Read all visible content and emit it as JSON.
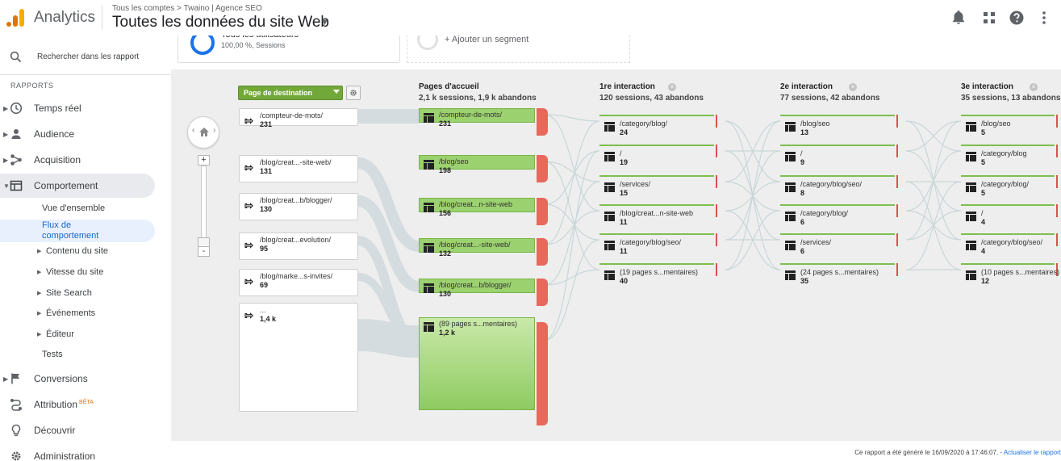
{
  "header": {
    "app_name": "Analytics",
    "breadcrumb": [
      "Tous les comptes",
      ">",
      "Twaino | Agence SEO"
    ],
    "view_title": "Toutes les données du site Web",
    "icons": [
      "notifications-icon",
      "apps-icon",
      "help-icon",
      "more-vert-icon"
    ]
  },
  "sidebar": {
    "search_label": "Rechercher dans les rapport",
    "reports_label": "RAPPORTS",
    "items": [
      {
        "label": "Temps réel",
        "icon": "clock-icon"
      },
      {
        "label": "Audience",
        "icon": "person-icon"
      },
      {
        "label": "Acquisition",
        "icon": "acquisition-icon"
      },
      {
        "label": "Comportement",
        "icon": "behavior-icon"
      }
    ],
    "behavior_sub": [
      {
        "label": "Vue d'ensemble"
      },
      {
        "label": "Flux de comportement"
      },
      {
        "label": "Contenu du site"
      },
      {
        "label": "Vitesse du site"
      },
      {
        "label": "Site Search"
      },
      {
        "label": "Événements"
      },
      {
        "label": "Éditeur"
      },
      {
        "label": "Tests"
      }
    ],
    "bottom_items": [
      {
        "label": "Conversions",
        "icon": "flag-icon"
      },
      {
        "label": "Attribution",
        "badge": "BÊTA",
        "icon": "attribution-icon"
      },
      {
        "label": "Découvrir",
        "icon": "lightbulb-icon"
      },
      {
        "label": "Administration",
        "icon": "gear-icon"
      }
    ]
  },
  "segments": {
    "active": {
      "title": "Tous les utilisateurs",
      "subtitle": "100,00 %, Sessions"
    },
    "add_label": "+ Ajouter un segment"
  },
  "flow": {
    "dimension": "Page de destination",
    "start_pages": [
      {
        "name": "/compteur-de-mots/",
        "value": "231"
      },
      {
        "name": "/blog/creat...-site-web/",
        "value": "131"
      },
      {
        "name": "/blog/creat...b/blogger/",
        "value": "130"
      },
      {
        "name": "/blog/creat...evolution/",
        "value": "95"
      },
      {
        "name": "/blog/marke...s-invites/",
        "value": "69"
      },
      {
        "name": "...",
        "value": "1,4 k"
      }
    ],
    "columns": [
      {
        "title": "Pages d'accueil",
        "subtitle": "2,1 k sessions, 1,9 k abandons",
        "nodes": [
          {
            "name": "/compteur-de-mots/",
            "value": "231"
          },
          {
            "name": "/blog/seo",
            "value": "198"
          },
          {
            "name": "/blog/creat...n-site-web",
            "value": "156"
          },
          {
            "name": "/blog/creat...-site-web/",
            "value": "132"
          },
          {
            "name": "/blog/creat...b/blogger/",
            "value": "130"
          },
          {
            "name": "(89 pages s...mentaires)",
            "value": "1,2 k"
          }
        ]
      },
      {
        "title": "1re interaction",
        "subtitle": "120 sessions, 43 abandons",
        "nodes": [
          {
            "name": "/category/blog/",
            "value": "24"
          },
          {
            "name": "/",
            "value": "19"
          },
          {
            "name": "/services/",
            "value": "15"
          },
          {
            "name": "/blog/creat...n-site-web",
            "value": "11"
          },
          {
            "name": "/category/blog/seo/",
            "value": "11"
          },
          {
            "name": "(19 pages s...mentaires)",
            "value": "40"
          }
        ]
      },
      {
        "title": "2e interaction",
        "subtitle": "77 sessions, 42 abandons",
        "nodes": [
          {
            "name": "/blog/seo",
            "value": "13"
          },
          {
            "name": "/",
            "value": "9"
          },
          {
            "name": "/category/blog/seo/",
            "value": "8"
          },
          {
            "name": "/category/blog/",
            "value": "6"
          },
          {
            "name": "/services/",
            "value": "6"
          },
          {
            "name": "(24 pages s...mentaires)",
            "value": "35"
          }
        ]
      },
      {
        "title": "3e interaction",
        "subtitle": "35 sessions, 13 abandons",
        "nodes": [
          {
            "name": "/blog/seo",
            "value": "5"
          },
          {
            "name": "/category/blog",
            "value": "5"
          },
          {
            "name": "/category/blog/",
            "value": "5"
          },
          {
            "name": "/",
            "value": "4"
          },
          {
            "name": "/category/blog/seo/",
            "value": "4"
          },
          {
            "name": "(10 pages s...mentaires)",
            "value": "12"
          }
        ]
      }
    ]
  },
  "footer": {
    "generated": "Ce rapport a été généré le 16/09/2020 à 17:46:07. - ",
    "refresh_link": "Actualiser le rapport"
  },
  "colors": {
    "node_green": "#8fcb61",
    "drop_red": "#e8685c",
    "link": "#1a73e8",
    "accent_orange": "#f9ab00"
  }
}
